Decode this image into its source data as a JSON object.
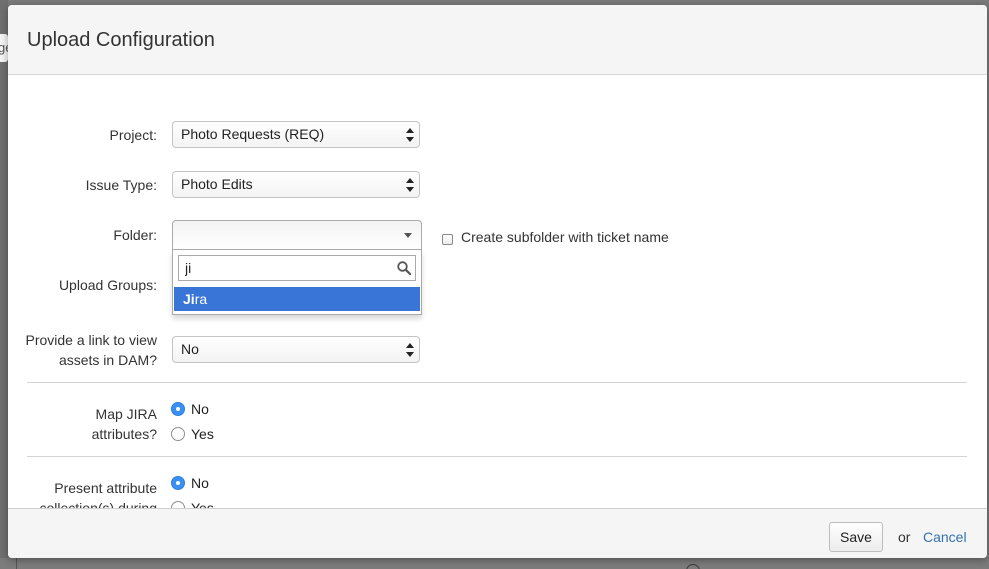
{
  "backdrop": {
    "fragment_text": "ge"
  },
  "dialog": {
    "title": "Upload Configuration"
  },
  "form": {
    "project": {
      "label": "Project:",
      "selected": "Photo Requests (REQ)"
    },
    "issue_type": {
      "label": "Issue Type:",
      "selected": "Photo Edits"
    },
    "folder": {
      "label": "Folder:",
      "selected": "",
      "search_value": "ji",
      "highlighted_option": "Jira",
      "option_match": "Ji",
      "option_rest": "ra",
      "subfolder_checkbox_label": "Create subfolder with ticket name",
      "subfolder_checked": false
    },
    "upload_groups": {
      "label": "Upload Groups:"
    },
    "dam_link": {
      "label_line1": "Provide a link to view",
      "label_line2": "assets in DAM?",
      "selected": "No"
    },
    "map_jira": {
      "label_line1": "Map JIRA",
      "label_line2": "attributes?",
      "options": [
        "No",
        "Yes"
      ],
      "selected": "No"
    },
    "present_attributes": {
      "label_line1": "Present attribute",
      "label_line2": "collection(s) during",
      "options": [
        "No",
        "Yes"
      ],
      "selected": "No"
    }
  },
  "footer": {
    "save_label": "Save",
    "or_text": "or",
    "cancel_label": "Cancel"
  },
  "colors": {
    "accent": "#3875d7",
    "link": "#3572b0",
    "radio_checked": "#3a8ff5"
  }
}
